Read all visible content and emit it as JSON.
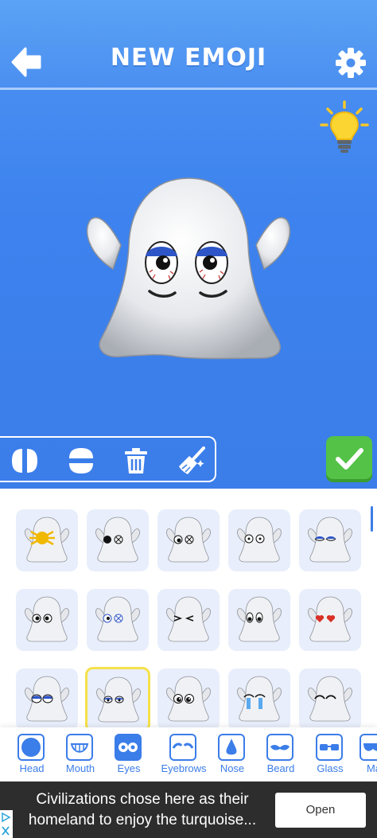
{
  "header": {
    "title": "NEW EMOJI"
  },
  "colors": {
    "accent": "#3b7de9",
    "confirm": "#53c246",
    "selected_border": "#f5e14a"
  },
  "icons": {
    "back": "arrow-left-icon",
    "settings": "gear-icon",
    "hint": "lightbulb-icon",
    "flip_horizontal": "flip-horizontal-icon",
    "flip_vertical": "flip-vertical-icon",
    "delete": "trash-icon",
    "clear": "broom-icon",
    "confirm": "checkmark-icon"
  },
  "eyes_grid": [
    "spider-eyes",
    "black-and-x-eyes",
    "black-and-x-eyes-alt",
    "dot-eyes",
    "sleepy-blue-eyes",
    "round-eyes",
    "x-eyes-blue",
    "squint-eyes",
    "big-round-eyes",
    "heart-eyes",
    "blue-lid-eyes",
    "blue-lid-eyes-small",
    "sparkle-eyes",
    "crying-eyes",
    "happy-closed-eyes"
  ],
  "categories": [
    {
      "label": "Head"
    },
    {
      "label": "Mouth"
    },
    {
      "label": "Eyes"
    },
    {
      "label": "Eyebrows"
    },
    {
      "label": "Nose"
    },
    {
      "label": "Beard"
    },
    {
      "label": "Glass"
    },
    {
      "label": "Ma"
    }
  ],
  "ad": {
    "text": "Civilizations chose here as their homeland to enjoy the turquoise...",
    "button": "Open"
  }
}
